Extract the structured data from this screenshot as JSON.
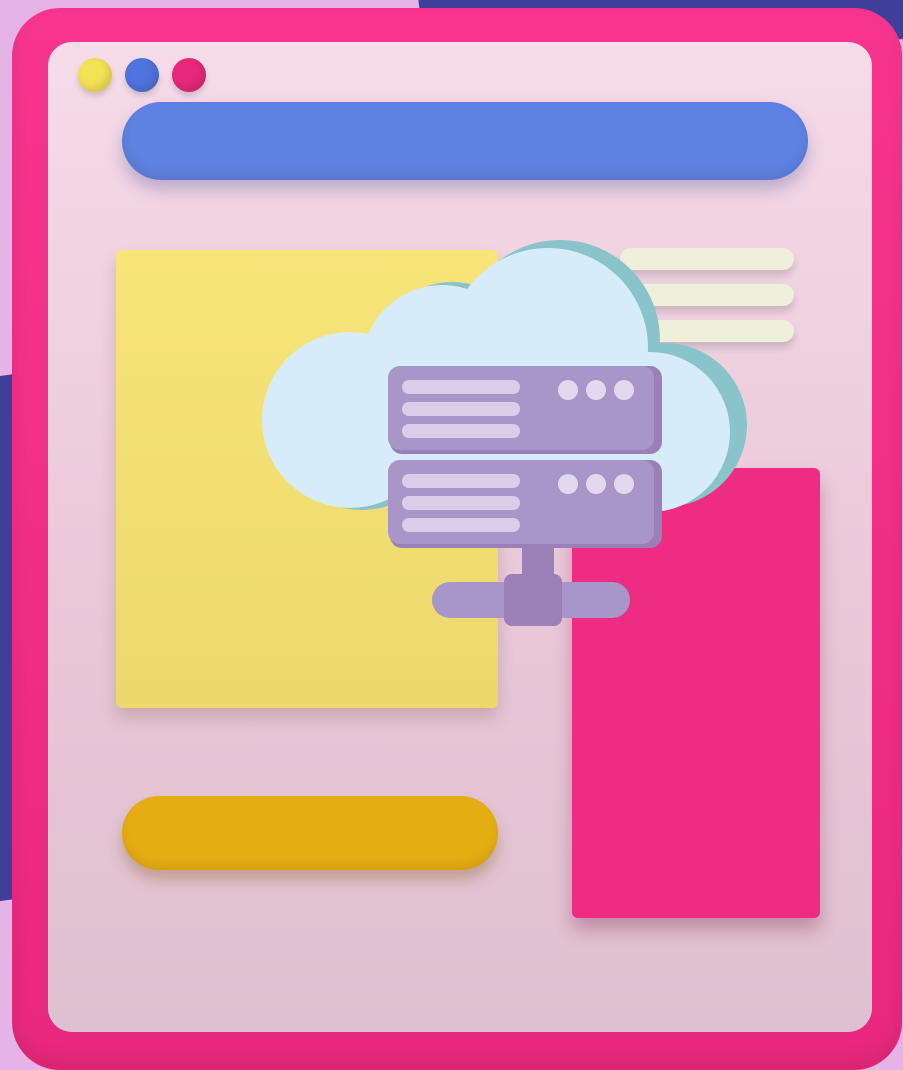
{
  "scene": {
    "description_free": true,
    "window_dots": [
      {
        "name": "yellow-dot",
        "color": "#f4e255"
      },
      {
        "name": "blue-dot",
        "color": "#4f74dd"
      },
      {
        "name": "magenta-dot",
        "color": "#e8287c"
      }
    ],
    "colors": {
      "background": "#e6b3e6",
      "background_shapes": "#3f3f9a",
      "frame": "#f7358f",
      "screen": "#f6dbe8",
      "address_bar": "#5e82e2",
      "yellow_card": "#f8e57a",
      "text_lines": "#eef0dc",
      "pink_card": "#ef2c84",
      "yellow_button": "#e4ad12",
      "cloud": "#d6ecfb",
      "cloud_shadow": "#88c4c9",
      "server": "#a896c9",
      "server_dark": "#9a80b6",
      "server_slot": "#d9cde8",
      "server_led": "#e2d9ee"
    },
    "icons": [
      "cloud-server-icon"
    ]
  }
}
